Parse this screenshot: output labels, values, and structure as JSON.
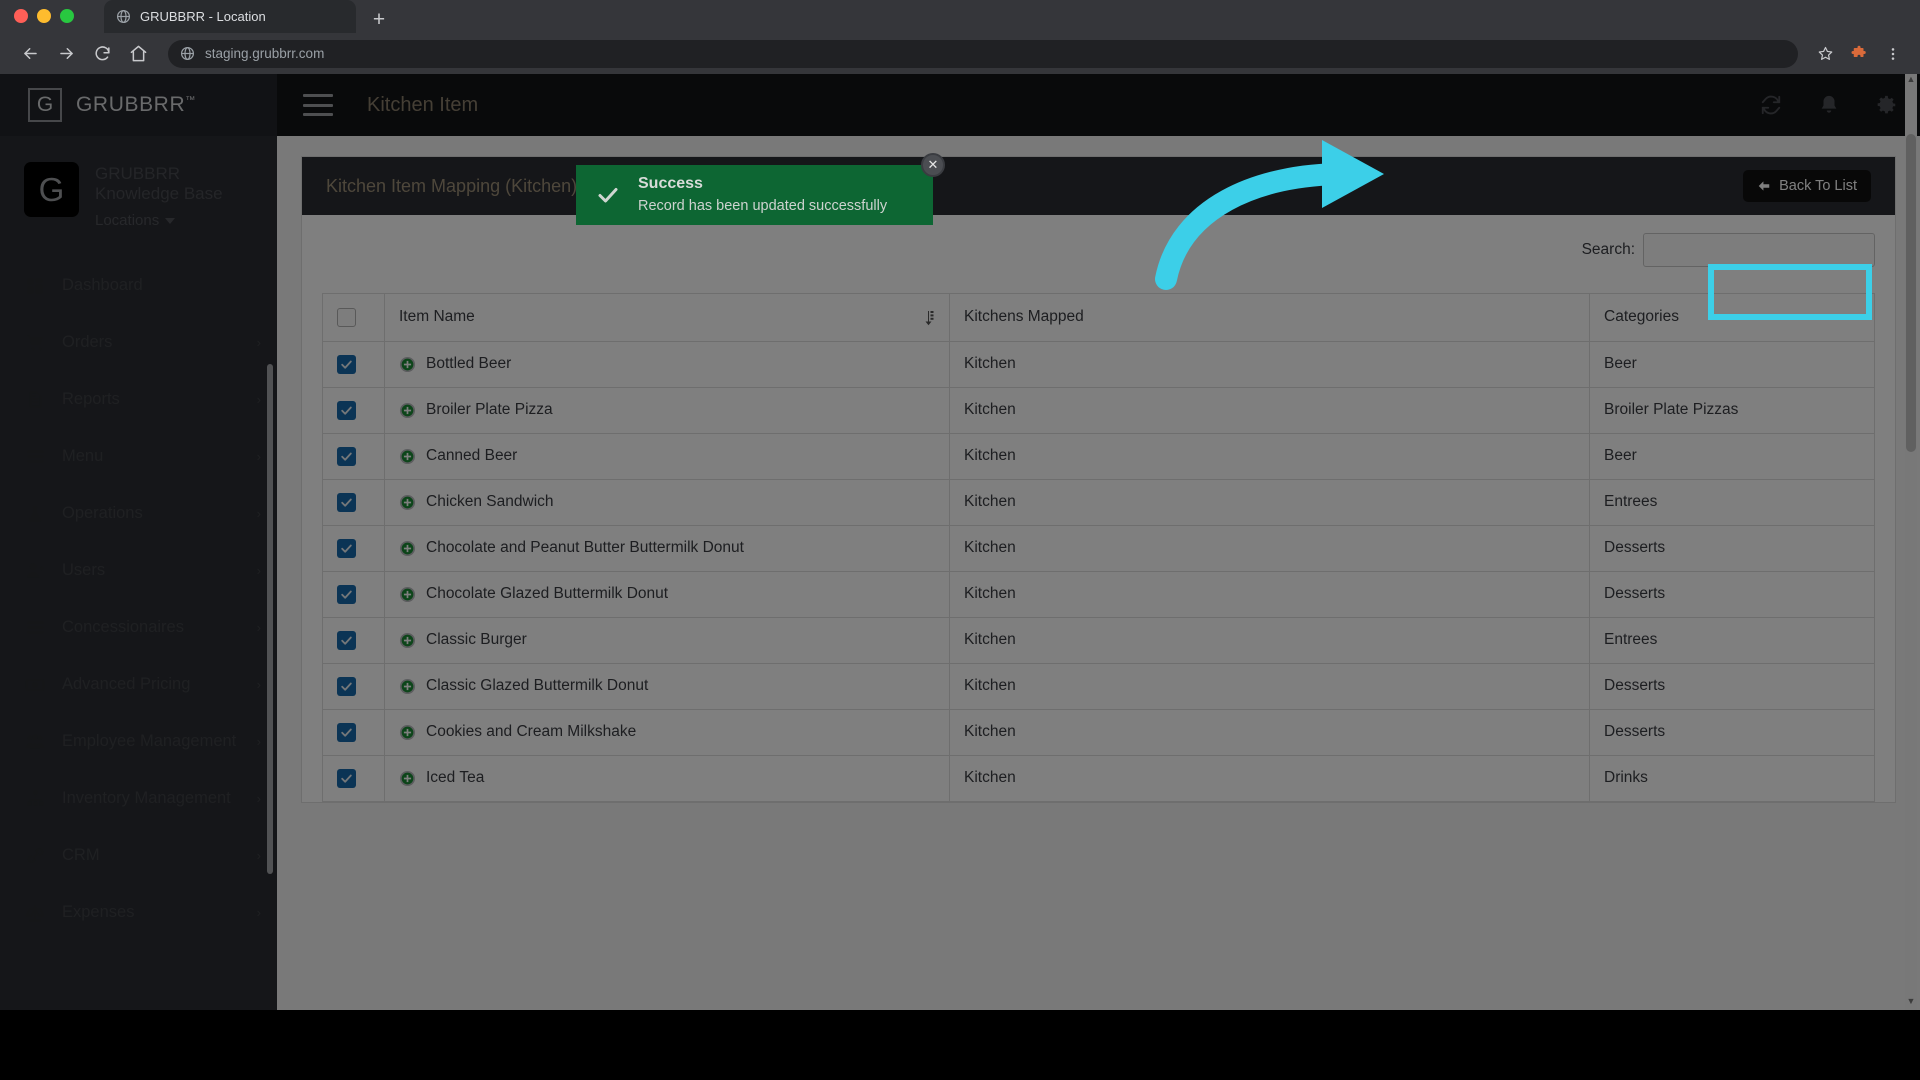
{
  "browser": {
    "tab_title": "GRUBBRR - Location",
    "url": "staging.grubbrr.com",
    "new_tab_label": "+",
    "back_icon": "arrow-left-icon",
    "forward_icon": "arrow-right-icon",
    "reload_icon": "reload-icon",
    "home_icon": "home-icon",
    "bookmark_icon": "star-icon",
    "extensions_icon": "puzzle-icon",
    "menu_icon": "kebab-menu-icon"
  },
  "sidebar": {
    "brand": "GRUBBRR",
    "brand_tm": "™",
    "brand_mark": "G",
    "account": {
      "avatar_letter": "G",
      "name_line1": "GRUBBRR",
      "name_line2": "Knowledge Base",
      "locations_label": "Locations"
    },
    "items": [
      {
        "label": "Dashboard",
        "icon": "dashboard-grid-icon",
        "has_chevron": false
      },
      {
        "label": "Orders",
        "icon": "shopping-cart-icon",
        "has_chevron": true
      },
      {
        "label": "Reports",
        "icon": "document-icon",
        "has_chevron": true
      },
      {
        "label": "Menu",
        "icon": "list-lines-icon",
        "has_chevron": true
      },
      {
        "label": "Operations",
        "icon": "flask-icon",
        "has_chevron": true
      },
      {
        "label": "Users",
        "icon": "user-plus-icon",
        "has_chevron": true
      },
      {
        "label": "Concessionaires",
        "icon": "list-lines-icon",
        "has_chevron": true
      },
      {
        "label": "Advanced Pricing",
        "icon": "banknote-icon",
        "has_chevron": true
      },
      {
        "label": "Employee Management",
        "icon": "people-group-icon",
        "has_chevron": true
      },
      {
        "label": "Inventory Management",
        "icon": "sitemap-icon",
        "has_chevron": true
      },
      {
        "label": "CRM",
        "icon": "link-chain-icon",
        "has_chevron": true
      },
      {
        "label": "Expenses",
        "icon": "scales-icon",
        "has_chevron": true
      }
    ]
  },
  "topbar": {
    "menu_toggle_icon": "hamburger-icon",
    "title": "Kitchen Item",
    "icons": [
      {
        "name": "sync-refresh-icon"
      },
      {
        "name": "bell-notification-icon"
      },
      {
        "name": "gear-settings-icon"
      }
    ]
  },
  "toast": {
    "icon": "check-icon",
    "title": "Success",
    "message": "Record has been updated successfully",
    "close_label": "✕",
    "color": "#0d6633"
  },
  "card": {
    "title": "Kitchen Item Mapping (Kitchen)",
    "back_button": "Back To List",
    "back_icon": "arrow-left-icon"
  },
  "search": {
    "label": "Search:",
    "value": "",
    "placeholder": ""
  },
  "table": {
    "select_all_checked": false,
    "columns": [
      "",
      "Item Name",
      "Kitchens Mapped",
      "Categories"
    ],
    "sort_column": "Item Name",
    "sort_icon": "sort-icon",
    "rows": [
      {
        "checked": true,
        "item": "Bottled Beer",
        "kitchen": "Kitchen",
        "category": "Beer",
        "tall": false
      },
      {
        "checked": true,
        "item": "Broiler Plate Pizza",
        "kitchen": "Kitchen",
        "category": "Broiler Plate Pizzas",
        "tall": true
      },
      {
        "checked": true,
        "item": "Canned Beer",
        "kitchen": "Kitchen",
        "category": "Beer",
        "tall": false
      },
      {
        "checked": true,
        "item": "Chicken Sandwich",
        "kitchen": "Kitchen",
        "category": "Entrees",
        "tall": false
      },
      {
        "checked": true,
        "item": "Chocolate and Peanut Butter Buttermilk Donut",
        "kitchen": "Kitchen",
        "category": "Desserts",
        "tall": false
      },
      {
        "checked": true,
        "item": "Chocolate Glazed Buttermilk Donut",
        "kitchen": "Kitchen",
        "category": "Desserts",
        "tall": false
      },
      {
        "checked": true,
        "item": "Classic Burger",
        "kitchen": "Kitchen",
        "category": "Entrees",
        "tall": false
      },
      {
        "checked": true,
        "item": "Classic Glazed Buttermilk Donut",
        "kitchen": "Kitchen",
        "category": "Desserts",
        "tall": false
      },
      {
        "checked": true,
        "item": "Cookies and Cream Milkshake",
        "kitchen": "Kitchen",
        "category": "Desserts",
        "tall": false
      },
      {
        "checked": true,
        "item": "Iced Tea",
        "kitchen": "Kitchen",
        "category": "Drinks",
        "tall": false
      }
    ],
    "row_icon": "green-plus-circle-icon"
  },
  "annotation": {
    "color": "#3ccfe8",
    "arrow_icon": "curved-arrow-icon",
    "highlight_target": "Back To List"
  }
}
